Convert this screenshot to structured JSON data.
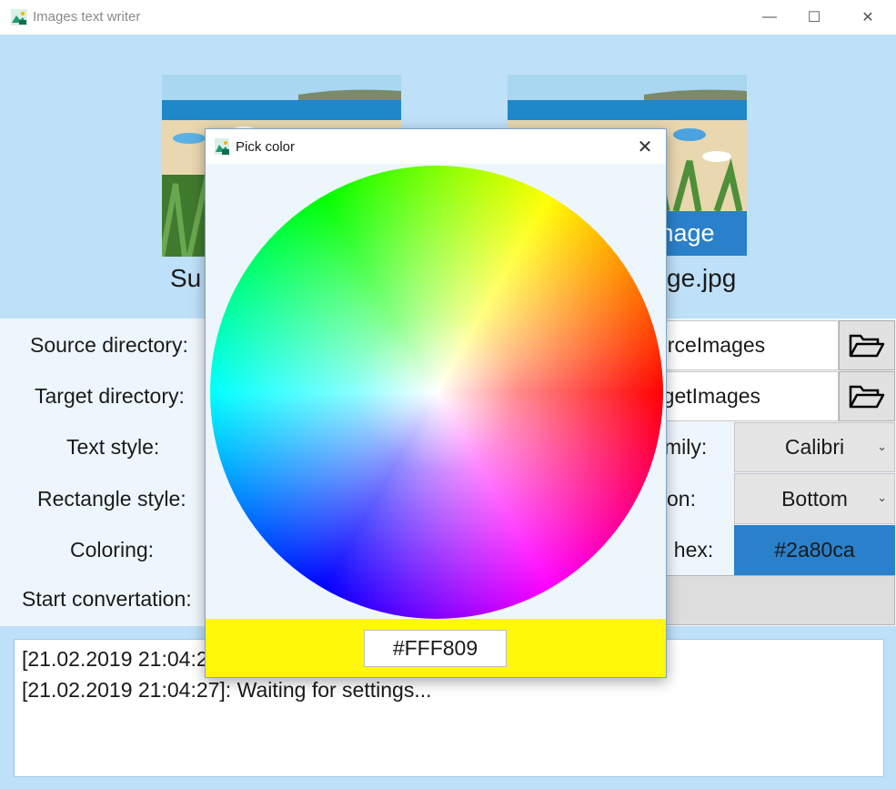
{
  "window": {
    "title": "Images text writer",
    "controls": {
      "minimize": "—",
      "maximize": "☐",
      "close": "✕"
    }
  },
  "previews": {
    "source_label": "Su",
    "target_label": "ge.jpg",
    "target_overlay_text": "nage",
    "overlay_color": "#2a80ca"
  },
  "settings": {
    "source_directory_label": "Source directory:",
    "source_directory_value": "urceImages",
    "target_directory_label": "Target directory:",
    "target_directory_value": "rgetImages",
    "text_style_label": "Text style:",
    "rectangle_style_label": "Rectangle style:",
    "coloring_label": "Coloring:",
    "start_label": "Start convertation:",
    "font_family_label": "mily:",
    "font_family_value": "Calibri",
    "position_label": "on:",
    "position_value": "Bottom",
    "hex_label": ", hex:",
    "hex_value": "#2a80ca",
    "icons": {
      "browse": "folder-open-icon",
      "dropdown": "chevron-down-icon"
    }
  },
  "log": {
    "lines": [
      "[21.02.2019 21:04:27",
      "[21.02.2019 21:04:27]: Waiting for settings..."
    ]
  },
  "dialog": {
    "title": "Pick color",
    "close": "✕",
    "selected_hex": "#FFF809",
    "selected_color": "#fff809"
  }
}
